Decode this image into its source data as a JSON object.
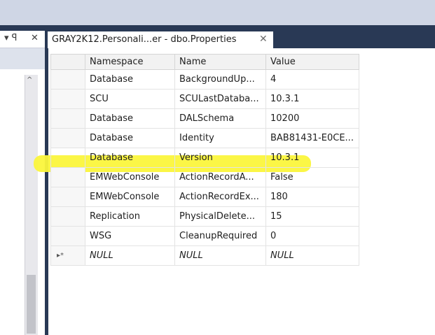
{
  "left_panel": {
    "pin_button": "▾ ꟼ",
    "close_button": "✕",
    "scroll_up_arrow": "^"
  },
  "document_tab": {
    "title": "GRAY2K12.Personali...er - dbo.Properties",
    "close_glyph": "✕"
  },
  "grid": {
    "columns": [
      "Namespace",
      "Name",
      "Value"
    ],
    "rows": [
      {
        "marker": "",
        "namespace": "Database",
        "name": "BackgroundUp...",
        "value": "4"
      },
      {
        "marker": "",
        "namespace": "SCU",
        "name": "SCULastDataba...",
        "value": "10.3.1"
      },
      {
        "marker": "",
        "namespace": "Database",
        "name": "DALSchema",
        "value": "10200"
      },
      {
        "marker": "",
        "namespace": "Database",
        "name": "Identity",
        "value": "BAB81431-E0CE..."
      },
      {
        "marker": "",
        "namespace": "Database",
        "name": "Version",
        "value": "10.3.1",
        "highlighted": true
      },
      {
        "marker": "",
        "namespace": "EMWebConsole",
        "name": "ActionRecordA...",
        "value": "False"
      },
      {
        "marker": "",
        "namespace": "EMWebConsole",
        "name": "ActionRecordEx...",
        "value": "180"
      },
      {
        "marker": "",
        "namespace": "Replication",
        "name": "PhysicalDelete...",
        "value": "15"
      },
      {
        "marker": "",
        "namespace": "WSG",
        "name": "CleanupRequired",
        "value": "0"
      },
      {
        "marker": "▸*",
        "namespace": "NULL",
        "name": "NULL",
        "value": "NULL",
        "is_new_row": true
      }
    ]
  },
  "colors": {
    "highlight": "#fbf63c",
    "tab_strip": "#293955",
    "top_band": "#cfd6e5"
  }
}
